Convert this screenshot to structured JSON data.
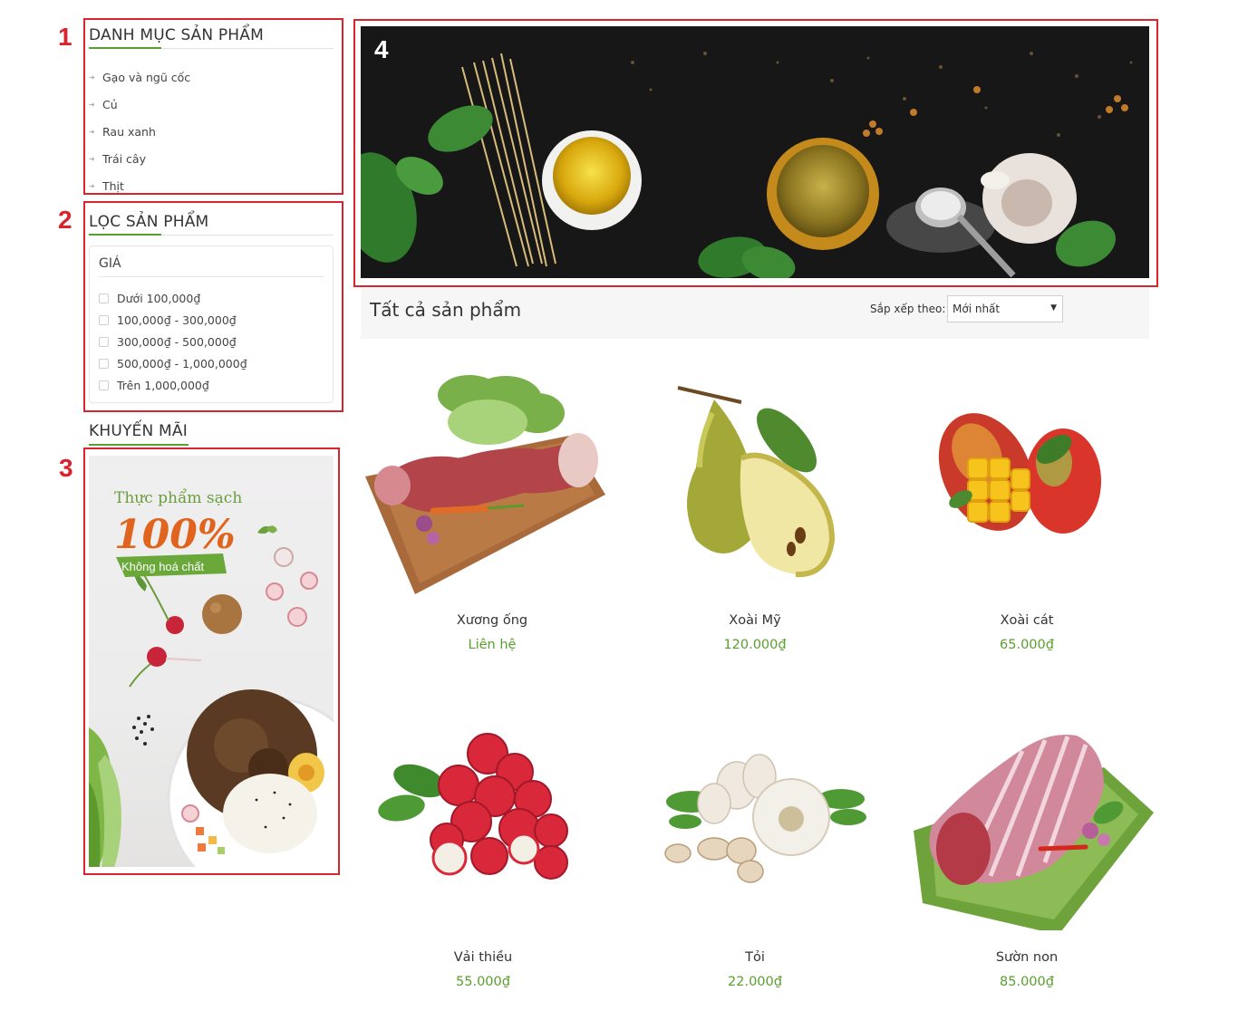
{
  "annotations": [
    "1",
    "2",
    "3",
    "4"
  ],
  "sidebar": {
    "categories": {
      "title": "DANH MỤC SẢN PHẨM",
      "items": [
        "Gạo và ngũ cốc",
        "Củ",
        "Rau xanh",
        "Trái cây",
        "Thịt"
      ]
    },
    "filter": {
      "title": "LỌC SẢN PHẨM",
      "group_label": "GIÁ",
      "options": [
        "Dưới 100,000₫",
        "100,000₫ - 300,000₫",
        "300,000₫ - 500,000₫",
        "500,000₫ - 1,000,000₫",
        "Trên 1,000,000₫"
      ]
    },
    "promotion": {
      "title": "KHUYẾN MÃI",
      "headline": "Thực phẩm sạch",
      "percent": "100%",
      "tagline": "Không hoá chất"
    }
  },
  "toolbar": {
    "title": "Tất cả sản phẩm",
    "sort_label": "Sắp xếp theo:",
    "sort_value": "Mới nhất"
  },
  "products": [
    {
      "name": "Xương ống",
      "price": "Liên hệ",
      "icon": "beef-bone-image"
    },
    {
      "name": "Xoài Mỹ",
      "price": "120.000₫",
      "icon": "pear-image"
    },
    {
      "name": "Xoài cát",
      "price": "65.000₫",
      "icon": "mango-image"
    },
    {
      "name": "Vải thiều",
      "price": "55.000₫",
      "icon": "lychee-image"
    },
    {
      "name": "Tỏi",
      "price": "22.000₫",
      "icon": "garlic-image"
    },
    {
      "name": "Sườn non",
      "price": "85.000₫",
      "icon": "pork-ribs-image"
    }
  ],
  "colors": {
    "accent_green": "#5a9e2f",
    "annotation_red": "#d9232d",
    "promo_orange": "#e0641e"
  }
}
